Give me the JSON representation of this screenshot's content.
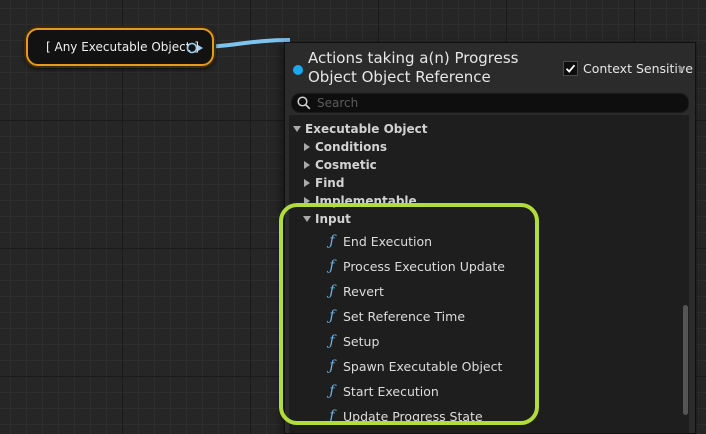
{
  "node": {
    "label": "[ Any Executable Object ]"
  },
  "panel": {
    "title": "Actions taking a(n) Progress Object Object Reference",
    "context_sensitive_label": "Context Sensitive",
    "context_sensitive_checked": true,
    "search_placeholder": "Search"
  },
  "tree": {
    "root": "Executable Object",
    "categories": [
      "Conditions",
      "Cosmetic",
      "Find",
      "Implementable"
    ],
    "input_category": "Input",
    "functions": [
      "End Execution",
      "Process Execution Update",
      "Revert",
      "Set Reference Time",
      "Setup",
      "Spawn Executable Object",
      "Start Execution",
      "Update Progress State"
    ]
  },
  "colors": {
    "node_border": "#e59a1b",
    "wire": "#7fc4ee",
    "highlight": "#b2dc3c",
    "function_icon": "#6fb7ea"
  },
  "icons": {
    "function": "function-f-icon",
    "search": "magnifier-icon"
  }
}
